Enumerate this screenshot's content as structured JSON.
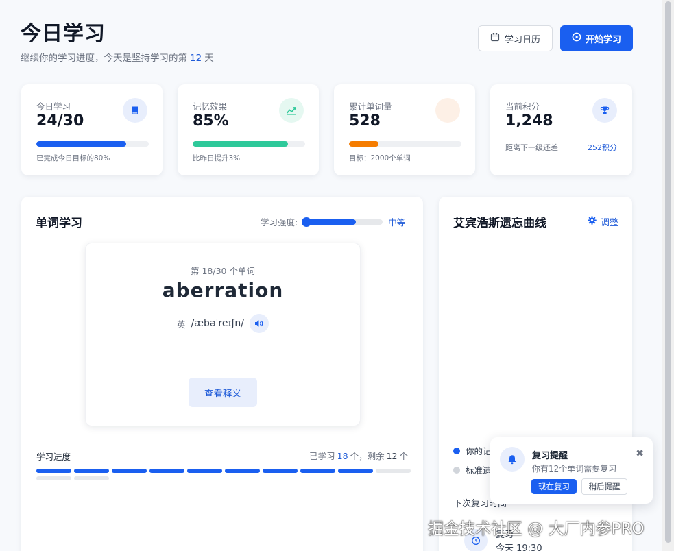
{
  "header": {
    "title": "今日学习",
    "subtitle_prefix": "继续你的学习进度，今天是坚持学习的第",
    "streak_days": "12",
    "subtitle_suffix": "天",
    "calendar_label": "学习日历",
    "start_label": "开始学习"
  },
  "stats": [
    {
      "label": "今日学习",
      "value": "24/30",
      "note": "已完成今日目标的80%",
      "progress": 0.8,
      "color": "#1a5ff0",
      "icon": "book-icon",
      "icon_bg": "#e8eefc"
    },
    {
      "label": "记忆效果",
      "value": "85%",
      "note": "比昨日提升3%",
      "progress": 0.85,
      "color": "#2ec99a",
      "icon": "trend-up-icon",
      "icon_bg": "#e5f8f1"
    },
    {
      "label": "累计单词量",
      "value": "528",
      "note": "目标：2000个单词",
      "progress": 0.26,
      "color": "#f57c00",
      "icon": "",
      "icon_bg": "#fdf0e6"
    },
    {
      "label": "当前积分",
      "value": "1,248",
      "note_left": "距离下一级还差",
      "note_right": "252积分",
      "icon": "trophy-icon",
      "icon_bg": "#e8eefc"
    }
  ],
  "study": {
    "title": "单词学习",
    "intensity_label": "学习强度:",
    "intensity_level": "中等",
    "intensity_value": 0.66,
    "card": {
      "counter": "第 18/30 个单词",
      "word": "aberration",
      "lang": "英",
      "phonetic": "/æbəˈreɪʃn/",
      "meaning_button": "查看释义"
    },
    "progress_label": "学习进度",
    "learned_prefix": "已学习",
    "learned_count": "18",
    "learned_suffix": "个，剩余",
    "remaining_count": "12",
    "remaining_suffix": "个",
    "segments_done": 9,
    "segments_total": 12
  },
  "curve": {
    "title": "艾宾浩斯遗忘曲线",
    "adjust_label": "调整",
    "legend_yours": "你的记",
    "legend_standard": "标准遗",
    "next_review_label": "下次复习时间",
    "review_item_label": "复习",
    "review_time": "今天 19:30",
    "color_yours": "#1a5ff0",
    "color_standard": "#d1d5db"
  },
  "toast": {
    "title": "复习提醒",
    "message": "你有12个单词需要复习",
    "now_label": "现在复习",
    "later_label": "稍后提醒",
    "close_glyph": "✖"
  },
  "watermark": "掘金技术社区 @ 大厂内参PRO"
}
